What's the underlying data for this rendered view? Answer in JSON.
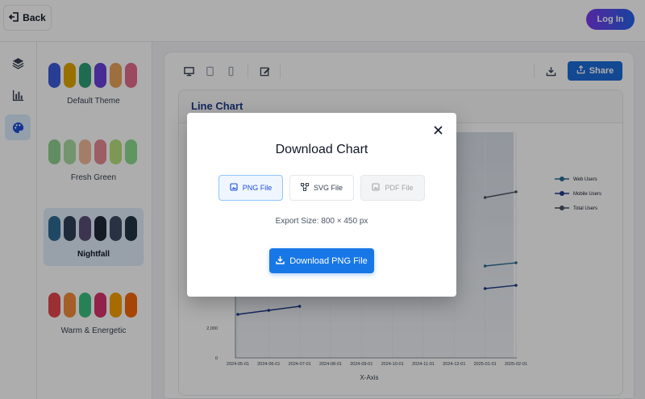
{
  "header": {
    "back_label": "Back",
    "login_label": "Log In"
  },
  "rail": {
    "items": [
      "layers-icon",
      "bar-chart-icon",
      "palette-icon"
    ],
    "active": "palette-icon"
  },
  "themes": [
    {
      "name": "Default Theme",
      "colors": [
        "#3b5bdb",
        "#e0a500",
        "#2f9e76",
        "#6741d9",
        "#e8a25c",
        "#e36c8b"
      ],
      "selected": false
    },
    {
      "name": "Fresh Green",
      "colors": [
        "#8fd18f",
        "#a8dca1",
        "#f2b89a",
        "#e88a96",
        "#b7e07d",
        "#8edb8e"
      ],
      "selected": false
    },
    {
      "name": "Nightfall",
      "colors": [
        "#2d6b92",
        "#2f3e58",
        "#5a4d7a",
        "#1f2937",
        "#3b4a63",
        "#243447"
      ],
      "selected": true
    },
    {
      "name": "Warm & Energetic",
      "colors": [
        "#e5484d",
        "#f08c3a",
        "#3cbf7e",
        "#d6336c",
        "#f59f00",
        "#f76707"
      ],
      "selected": false
    }
  ],
  "toolbar": {
    "tools": [
      "desktop-icon",
      "tablet-icon",
      "mobile-icon",
      "edit-icon"
    ],
    "download_icon": "download-icon",
    "share_label": "Share"
  },
  "chart": {
    "title": "Line Chart",
    "xlabel": "X-Axis"
  },
  "chart_data": {
    "type": "line",
    "x": [
      "2024-05-01",
      "2024-06-01",
      "2024-07-01",
      "2024-08-01",
      "2024-09-01",
      "2024-10-01",
      "2024-11-01",
      "2024-12-01",
      "2025-01-01",
      "2025-02-01"
    ],
    "ytick_labels": [
      "0",
      "2,000"
    ],
    "series": [
      {
        "name": "Web Users",
        "color": "#2d6b92"
      },
      {
        "name": "Mobile Users",
        "color": "#1e3a8a"
      },
      {
        "name": "Total Users",
        "color": "#4b5563"
      }
    ],
    "xlabel": "X-Axis",
    "legend": "right"
  },
  "modal": {
    "title": "Download Chart",
    "formats": [
      {
        "label": "PNG File",
        "icon": "image-icon",
        "state": "active"
      },
      {
        "label": "SVG File",
        "icon": "vector-icon",
        "state": "normal"
      },
      {
        "label": "PDF File",
        "icon": "pdf-icon",
        "state": "disabled"
      }
    ],
    "export_size": "Export Size: 800 × 450 px",
    "download_label": "Download PNG File"
  }
}
